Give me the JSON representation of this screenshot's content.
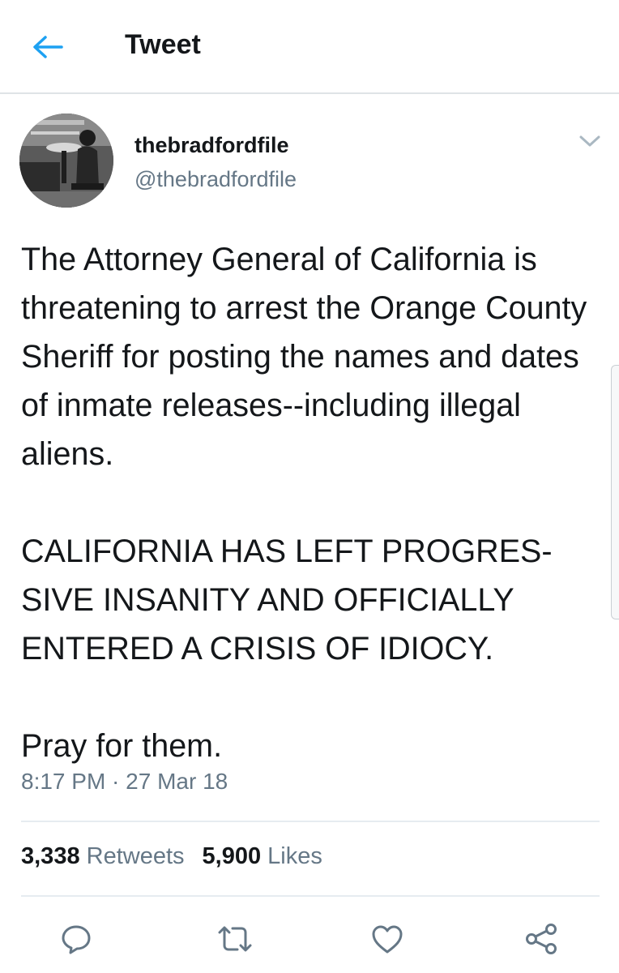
{
  "header": {
    "title": "Tweet",
    "back_icon": "arrow-left-icon",
    "accent_color": "#1da1f2"
  },
  "author": {
    "display_name": "thebradfordfile",
    "handle": "@thebradfordfile"
  },
  "tweet": {
    "paragraphs": [
      "The Attorney General of California is threatening to arrest the Orange County Sheriff for posting the names and dates of inmate releases--including illegal aliens.",
      "CALIFORNIA HAS LEFT PROGRES-SIVE INSANITY AND OFFICIALLY ENTERED A CRISIS OF IDIOCY.",
      "Pray for them."
    ],
    "timestamp": "8:17 PM · 27 Mar 18"
  },
  "stats": {
    "retweets_count": "3,338",
    "retweets_label": "Retweets",
    "likes_count": "5,900",
    "likes_label": "Likes"
  },
  "actions": [
    "reply-icon",
    "retweet-icon",
    "heart-icon",
    "share-icon"
  ]
}
